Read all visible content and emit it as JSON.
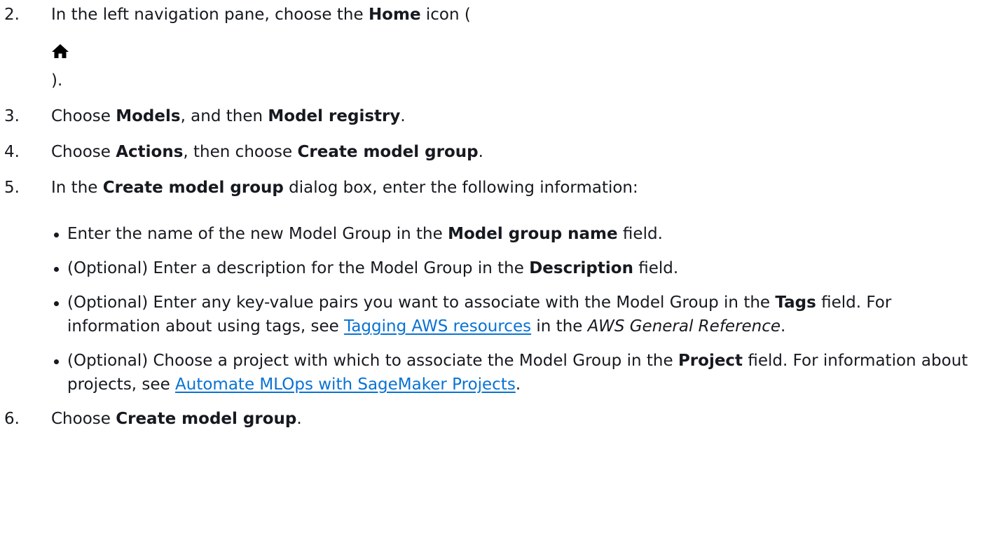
{
  "steps": [
    {
      "number": "2.",
      "line1_pre": "In the left navigation pane, choose the ",
      "line1_bold": "Home",
      "line1_post": " icon (",
      "icon": "home-icon",
      "line3": ")."
    },
    {
      "number": "3.",
      "pre": "Choose ",
      "bold1": "Models",
      "mid": ", and then ",
      "bold2": "Model registry",
      "post": "."
    },
    {
      "number": "4.",
      "pre": "Choose ",
      "bold1": "Actions",
      "mid": ", then choose ",
      "bold2": "Create model group",
      "post": "."
    },
    {
      "number": "5.",
      "pre": "In the ",
      "bold": "Create model group",
      "post": " dialog box, enter the following information:",
      "bullets": [
        {
          "pre": "Enter the name of the new Model Group in the ",
          "bold": "Model group name",
          "post": " field."
        },
        {
          "pre": "(Optional) Enter a description for the Model Group in the ",
          "bold": "Description",
          "post": " field."
        },
        {
          "pre": "(Optional) Enter any key-value pairs you want to associate with the Model Group in the ",
          "bold": "Tags",
          "mid": " field. For information about using tags, see ",
          "link": "Tagging AWS resources",
          "mid2": " in the ",
          "italic": "AWS General Reference",
          "post": "."
        },
        {
          "pre": "(Optional) Choose a project with which to associate the Model Group in the ",
          "bold": "Project",
          "mid": " field. For information about projects, see ",
          "link": "Automate MLOps with SageMaker Projects",
          "post": "."
        }
      ]
    },
    {
      "number": "6.",
      "pre": "Choose ",
      "bold": "Create model group",
      "post": "."
    }
  ],
  "colors": {
    "text": "#16191f",
    "link": "#0972d3"
  }
}
